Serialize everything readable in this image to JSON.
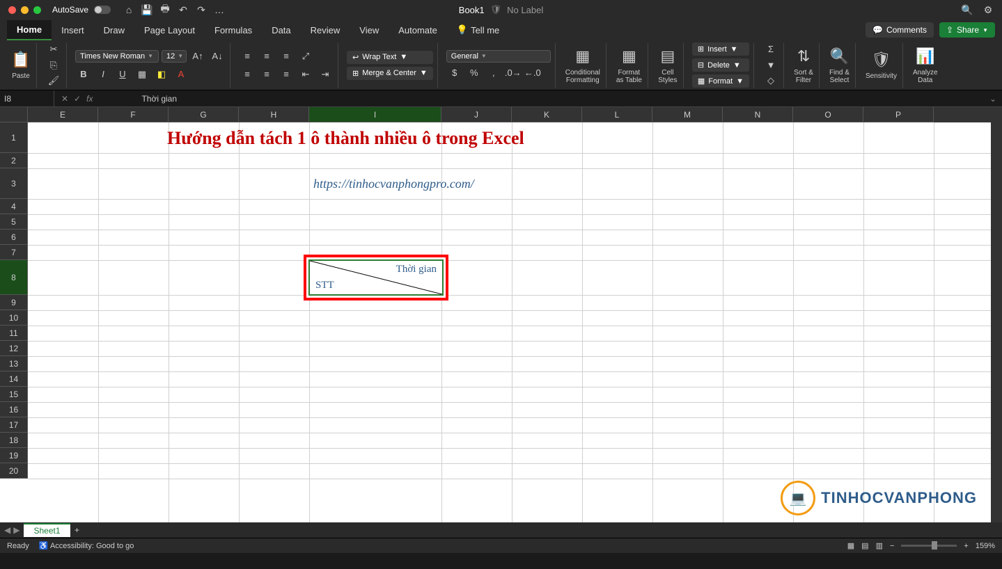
{
  "titlebar": {
    "autosave": "AutoSave",
    "book": "Book1",
    "label": "No Label"
  },
  "tabs": [
    "Home",
    "Insert",
    "Draw",
    "Page Layout",
    "Formulas",
    "Data",
    "Review",
    "View",
    "Automate",
    "Tell me"
  ],
  "tabs_right": {
    "comments": "Comments",
    "share": "Share"
  },
  "ribbon": {
    "paste": "Paste",
    "font_name": "Times New Roman",
    "font_size": "12",
    "wrap": "Wrap Text",
    "merge": "Merge & Center",
    "number_format": "General",
    "cond": "Conditional\nFormatting",
    "fmt_table": "Format\nas Table",
    "styles": "Cell\nStyles",
    "insert": "Insert",
    "delete": "Delete",
    "format": "Format",
    "sort": "Sort &\nFilter",
    "find": "Find &\nSelect",
    "sens": "Sensitivity",
    "analyze": "Analyze\nData"
  },
  "fbar": {
    "name": "I8",
    "value": "Thời gian"
  },
  "columns": [
    "E",
    "F",
    "G",
    "H",
    "I",
    "J",
    "K",
    "L",
    "M",
    "N",
    "O",
    "P"
  ],
  "rows": [
    "1",
    "2",
    "3",
    "4",
    "5",
    "6",
    "7",
    "8",
    "9",
    "10",
    "11",
    "12",
    "13",
    "14",
    "15",
    "16",
    "17",
    "18",
    "19",
    "20"
  ],
  "content": {
    "title": "Hướng dẫn tách 1 ô thành nhiều ô trong Excel",
    "url": "https://tinhocvanphongpro.com/",
    "split_tr": "Thời gian",
    "split_bl": "STT"
  },
  "watermark": "TINHOCVANPHONG",
  "sheet": "Sheet1",
  "status": {
    "ready": "Ready",
    "acc": "Accessibility: Good to go",
    "zoom": "159%"
  }
}
